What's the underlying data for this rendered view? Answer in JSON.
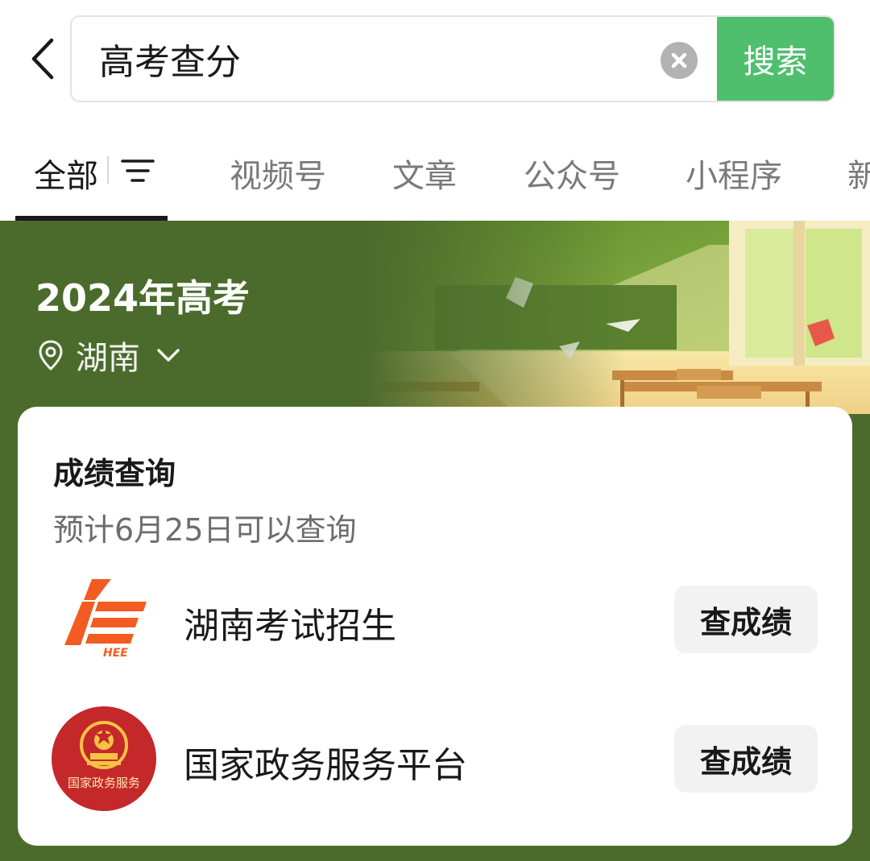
{
  "search": {
    "query": "高考查分",
    "button_label": "搜索"
  },
  "tabs": [
    {
      "label": "全部",
      "active": true
    },
    {
      "label": "视频号",
      "active": false
    },
    {
      "label": "文章",
      "active": false
    },
    {
      "label": "公众号",
      "active": false
    },
    {
      "label": "小程序",
      "active": false
    },
    {
      "label": "新",
      "active": false
    }
  ],
  "banner": {
    "title": "2024年高考",
    "location": "湖南"
  },
  "card": {
    "title": "成绩查询",
    "subtitle": "预计6月25日可以查询",
    "services": [
      {
        "name": "湖南考试招生",
        "button_label": "查成绩",
        "icon": "hee-logo-icon",
        "logo_text": "HEE"
      },
      {
        "name": "国家政务服务平台",
        "button_label": "查成绩",
        "icon": "national-emblem-icon",
        "logo_text": "国家政务服务"
      }
    ]
  },
  "colors": {
    "accent": "#4fbf6e",
    "banner_green": "#4b6b2c",
    "hee_orange": "#f25c22",
    "gov_red": "#c4282a"
  }
}
